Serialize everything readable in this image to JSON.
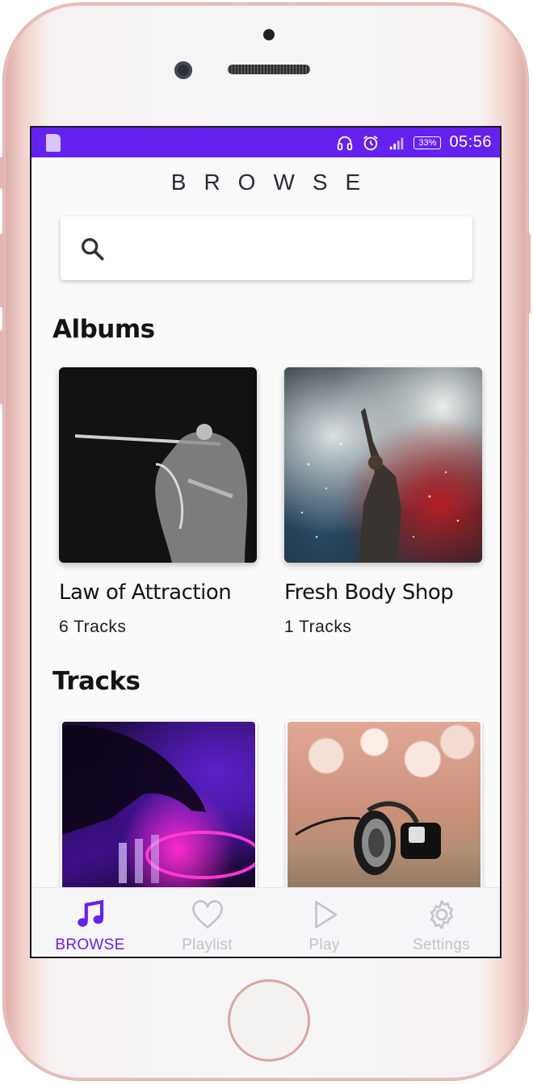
{
  "colors": {
    "accent": "#6521ee",
    "status_bar": "#6521ee",
    "inactive": "#c3c3c8"
  },
  "status_bar": {
    "battery": "33%",
    "time": "05:56"
  },
  "header": {
    "title": "BROWSE"
  },
  "search": {
    "placeholder": "",
    "value": ""
  },
  "albums": {
    "title": "Albums",
    "items": [
      {
        "title": "Law of Attraction",
        "subtitle": "6 Tracks"
      },
      {
        "title": "Fresh Body Shop",
        "subtitle": "1 Tracks"
      }
    ]
  },
  "tracks": {
    "title": "Tracks"
  },
  "bottom_nav": {
    "items": [
      {
        "label": "BROWSE",
        "icon": "music-note-icon",
        "active": true
      },
      {
        "label": "Playlist",
        "icon": "heart-icon",
        "active": false
      },
      {
        "label": "Play",
        "icon": "play-icon",
        "active": false
      },
      {
        "label": "Settings",
        "icon": "gear-icon",
        "active": false
      }
    ]
  }
}
